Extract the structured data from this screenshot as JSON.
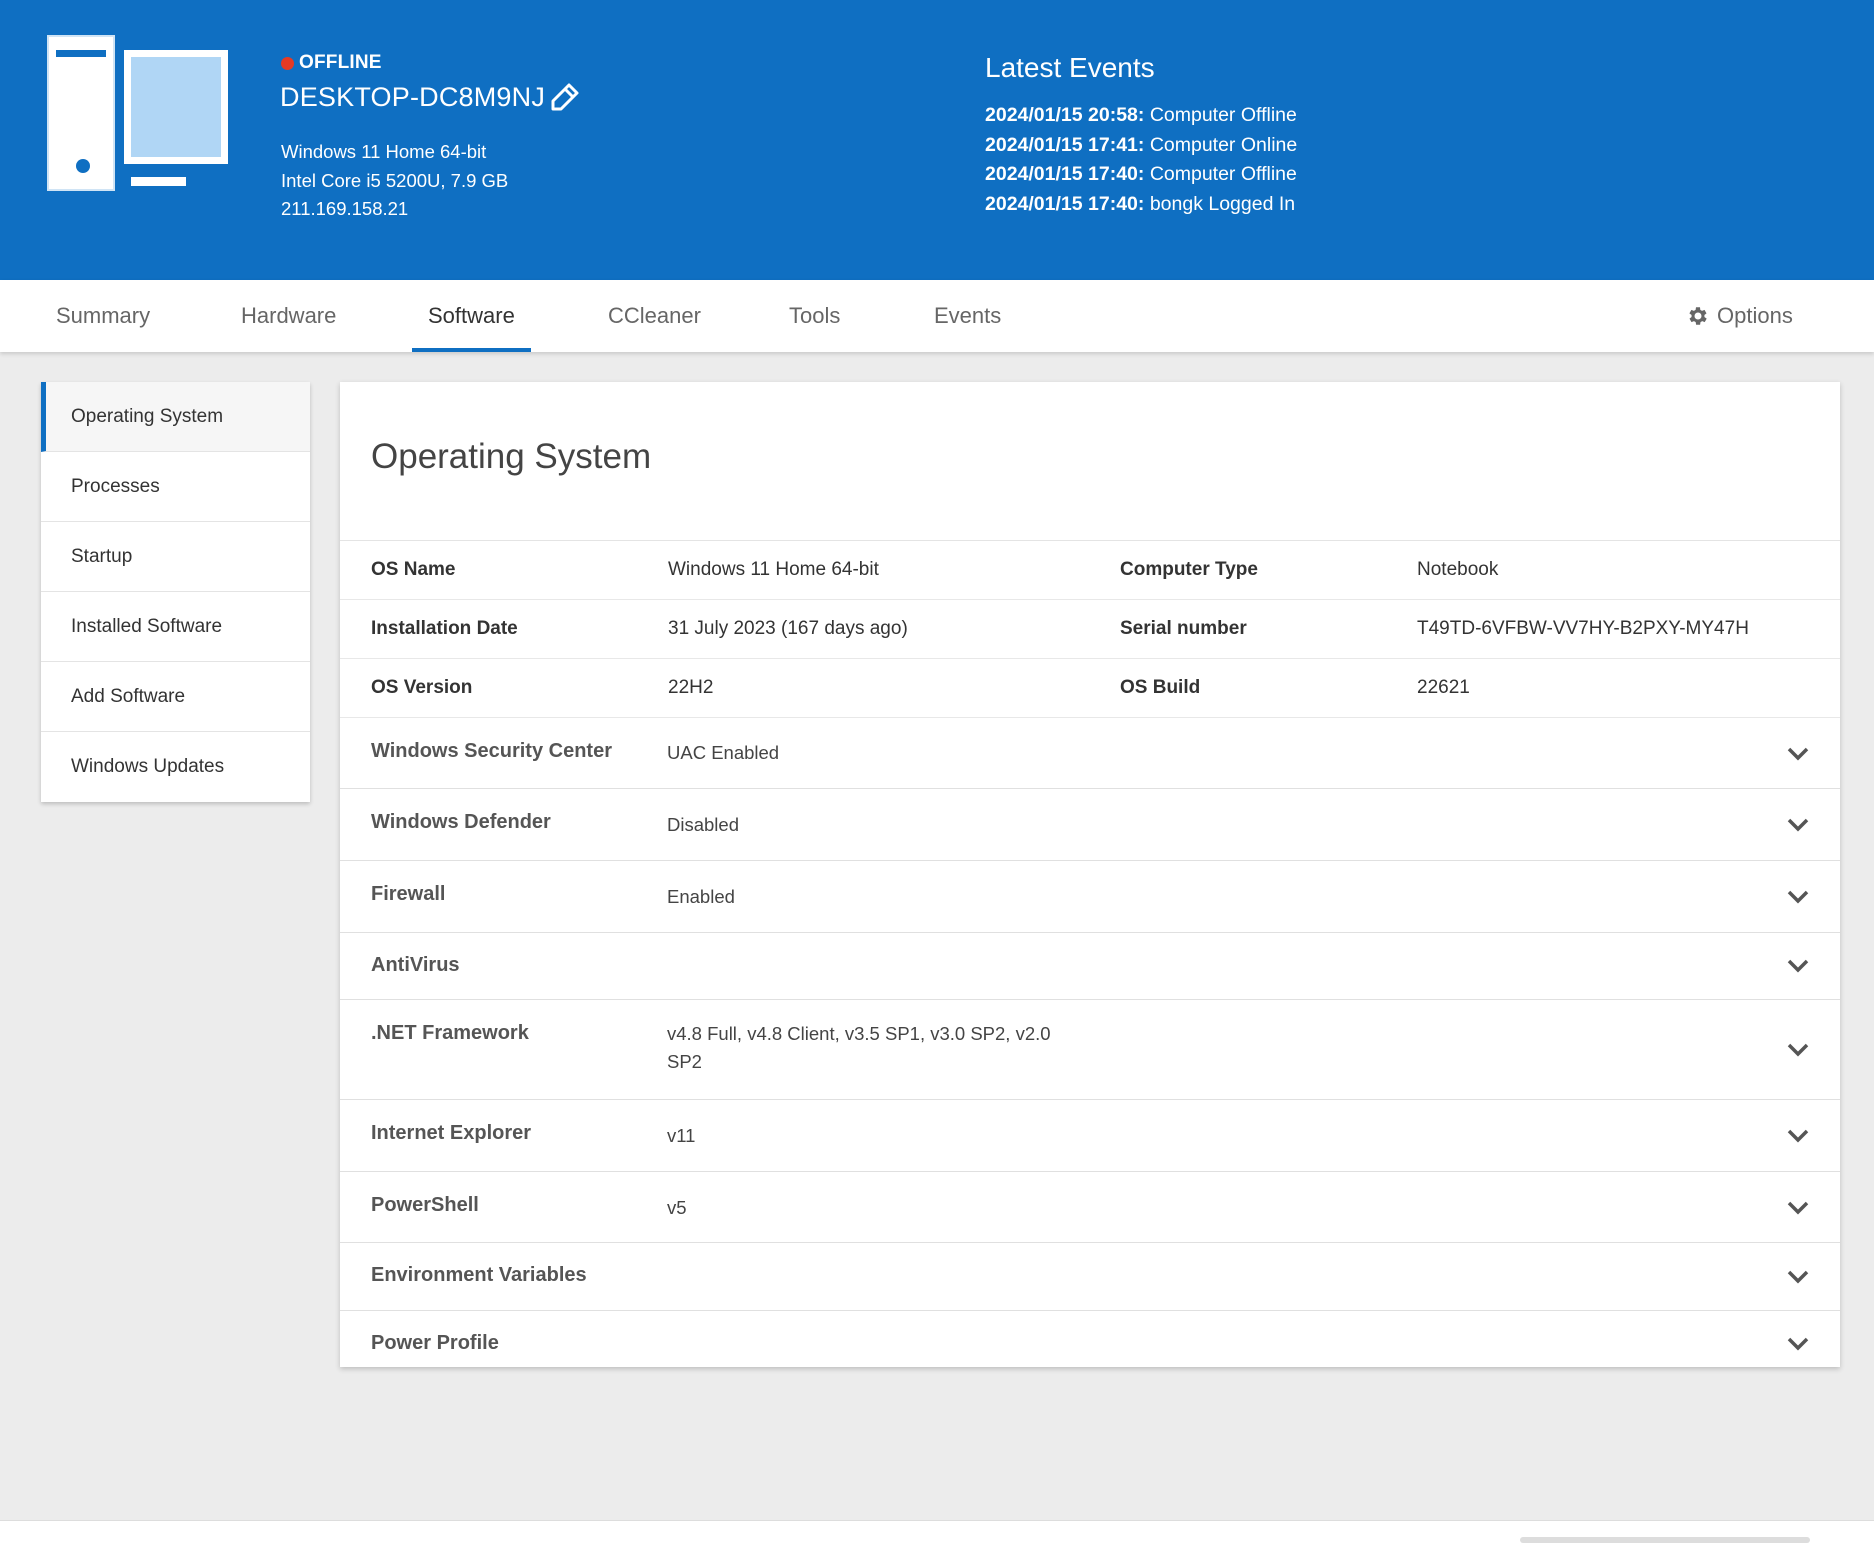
{
  "header": {
    "status": "OFFLINE",
    "status_color": "#e53a24",
    "computer_name": "DESKTOP-DC8M9NJ",
    "os": "Windows 11 Home 64-bit",
    "cpu": "Intel Core i5 5200U, 7.9 GB",
    "ip": "211.169.158.21",
    "events_title": "Latest Events",
    "events": [
      {
        "time": "2024/01/15 20:58:",
        "text": "Computer Offline"
      },
      {
        "time": "2024/01/15 17:41:",
        "text": "Computer Online"
      },
      {
        "time": "2024/01/15 17:40:",
        "text": "Computer Offline"
      },
      {
        "time": "2024/01/15 17:40:",
        "text": "bongk Logged In"
      }
    ]
  },
  "tabs": [
    {
      "label": "Summary"
    },
    {
      "label": "Hardware"
    },
    {
      "label": "Software",
      "active": true
    },
    {
      "label": "CCleaner"
    },
    {
      "label": "Tools"
    },
    {
      "label": "Events"
    }
  ],
  "options_label": "Options",
  "sidebar": {
    "items": [
      {
        "label": "Operating System",
        "active": true
      },
      {
        "label": "Processes"
      },
      {
        "label": "Startup"
      },
      {
        "label": "Installed Software"
      },
      {
        "label": "Add Software"
      },
      {
        "label": "Windows Updates"
      }
    ]
  },
  "main": {
    "title": "Operating System",
    "info": [
      {
        "label1": "OS Name",
        "value1": "Windows 11 Home 64-bit",
        "label2": "Computer Type",
        "value2": "Notebook"
      },
      {
        "label1": "Installation Date",
        "value1": "31 July 2023 (167 days ago)",
        "label2": "Serial number",
        "value2": "T49TD-6VFBW-VV7HY-B2PXY-MY47H"
      },
      {
        "label1": "OS Version",
        "value1": "22H2",
        "label2": "OS Build",
        "value2": "22621"
      }
    ],
    "sections": [
      {
        "label": "Windows Security Center",
        "value": "UAC Enabled"
      },
      {
        "label": "Windows Defender",
        "value": "Disabled"
      },
      {
        "label": "Firewall",
        "value": "Enabled"
      },
      {
        "label": "AntiVirus",
        "value": ""
      },
      {
        "label": ".NET Framework",
        "value": "v4.8 Full, v4.8 Client, v3.5 SP1, v3.0 SP2, v2.0 SP2"
      },
      {
        "label": "Internet Explorer",
        "value": "v11"
      },
      {
        "label": "PowerShell",
        "value": "v5"
      },
      {
        "label": "Environment Variables",
        "value": ""
      },
      {
        "label": "Power Profile",
        "value": ""
      }
    ]
  },
  "colors": {
    "accent": "#0f6fc2",
    "header_bg": "#0f6fc2"
  }
}
